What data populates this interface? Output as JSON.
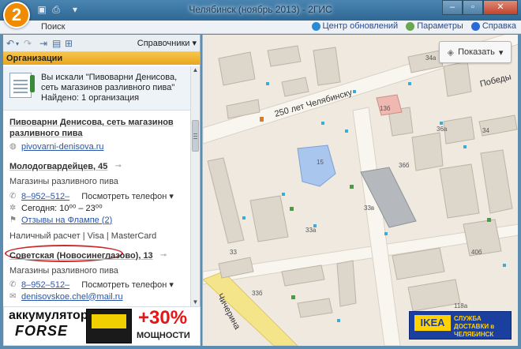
{
  "titlebar": {
    "logo_label": "2",
    "title": "Челябинск (ноябрь 2013) - 2ГИС"
  },
  "menubar": {
    "search": "Поиск",
    "updates": "Центр обновлений",
    "params": "Параметры",
    "help": "Справка"
  },
  "panel": {
    "directory": "Справочники",
    "section": "Организации",
    "search_summary": "Вы искали \"Пивоварни Денисова, сеть магазинов разливного пива\"",
    "found": "Найдено: 1 организация",
    "org_title": "Пивоварни Денисова, сеть магазинов разливного пива",
    "website": "pivovarni-denisova.ru",
    "branch1": {
      "address": "Молодогвардейцев, 45",
      "category": "Магазины разливного пива",
      "phone": "8–952–512–",
      "phone_more": "Посмотреть телефон",
      "hours": "Сегодня: 10⁰⁰ – 23⁰⁰",
      "reviews": "Отзывы на Флампе (2)",
      "payment": "Наличный расчет | Visa | MasterCard"
    },
    "branch2": {
      "address": "Советская (Новосинеглазово), 13",
      "category": "Магазины разливного пива",
      "phone": "8–952–512–",
      "phone_more": "Посмотреть телефон",
      "email": "denisovskoe.chel@mail.ru"
    }
  },
  "banner": {
    "line1": "аккумулятор",
    "line2": "FORSE",
    "percent": "+30%",
    "power": "МОЩНОСТИ"
  },
  "map": {
    "show_button": "Показать",
    "streets": {
      "s250": "250 лет Челябинску",
      "pobedy": "Победы",
      "chicherina": "Чичерина"
    },
    "buildings": [
      "34а",
      "13б",
      "36а",
      "34",
      "15",
      "33в",
      "36б",
      "33а",
      "40б",
      "33",
      "33б",
      "118а"
    ],
    "ikea_logo": "IKEA",
    "ikea_text": "СЛУЖБА ДОСТАВКИ в ЧЕЛЯБИНСК"
  },
  "colors": {
    "accent_orange": "#f08a00",
    "link": "#2a55a8",
    "oval": "#cc2a2a",
    "section": "#f0b433"
  }
}
